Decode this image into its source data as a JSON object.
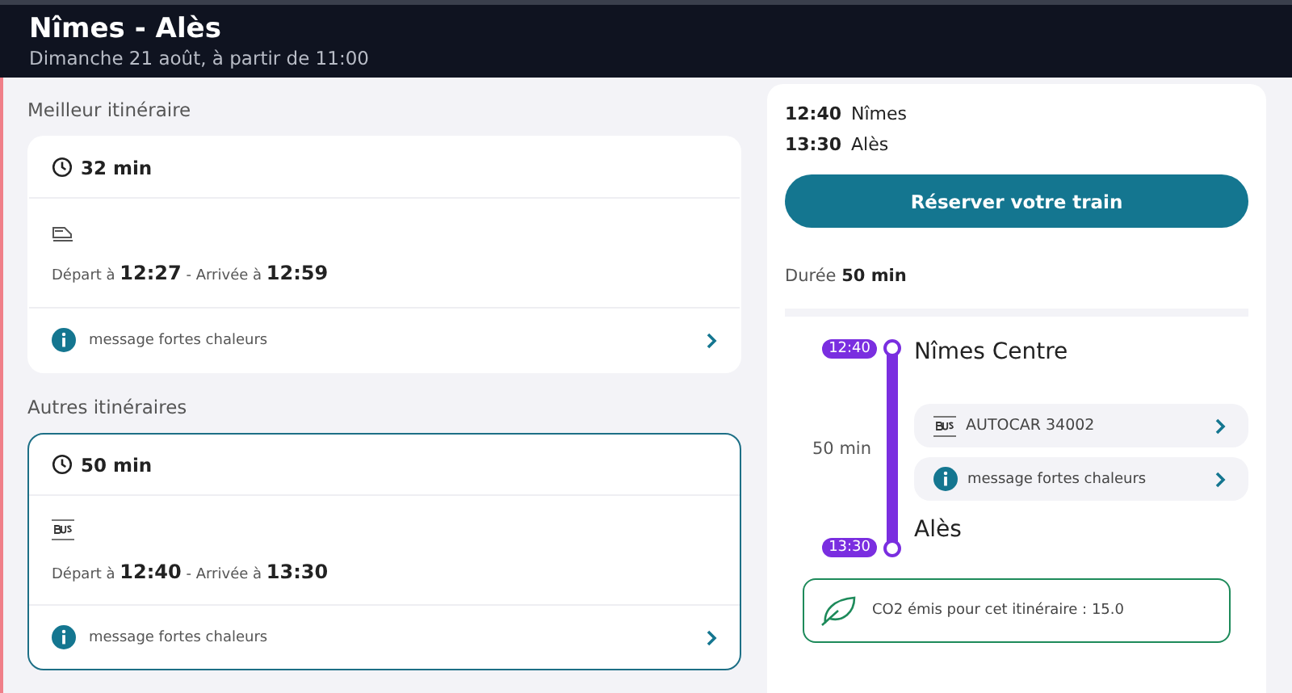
{
  "header": {
    "title": "Nîmes - Alès",
    "subtitle": "Dimanche 21 août, à partir de 11:00"
  },
  "sections": [
    {
      "title": "Meilleur itinéraire",
      "itineraries": [
        {
          "duration": "32 min",
          "kind": "train",
          "times": "Départ à **12:27** - Arrivée à **12:59**",
          "message": "message fortes chaleurs",
          "selected": false
        }
      ]
    },
    {
      "title": "Autres itinéraires",
      "itineraries": [
        {
          "duration": "50 min",
          "kind": "bus",
          "times": "Départ à **12:40** - Arrivée à **13:30**",
          "message": "message fortes chaleurs",
          "selected": true
        }
      ]
    }
  ],
  "detail": {
    "stops": [
      {
        "time": "12:40",
        "place": "Nîmes"
      },
      {
        "time": "13:30",
        "place": "Alès"
      }
    ],
    "button": "Réserver votre train",
    "duration": "Durée **50 min**",
    "timeline": {
      "start": {
        "time": "12:40",
        "place": "Nîmes Centre"
      },
      "end": {
        "time": "13:30",
        "place": "Alès"
      },
      "duration": "50 min",
      "legs": [
        {
          "kind": "bus",
          "label": "AUTOCAR 34002"
        },
        {
          "kind": "info",
          "label": "message fortes chaleurs"
        }
      ]
    },
    "co2": "CO2 émis pour cet itinéraire : 15.0"
  }
}
